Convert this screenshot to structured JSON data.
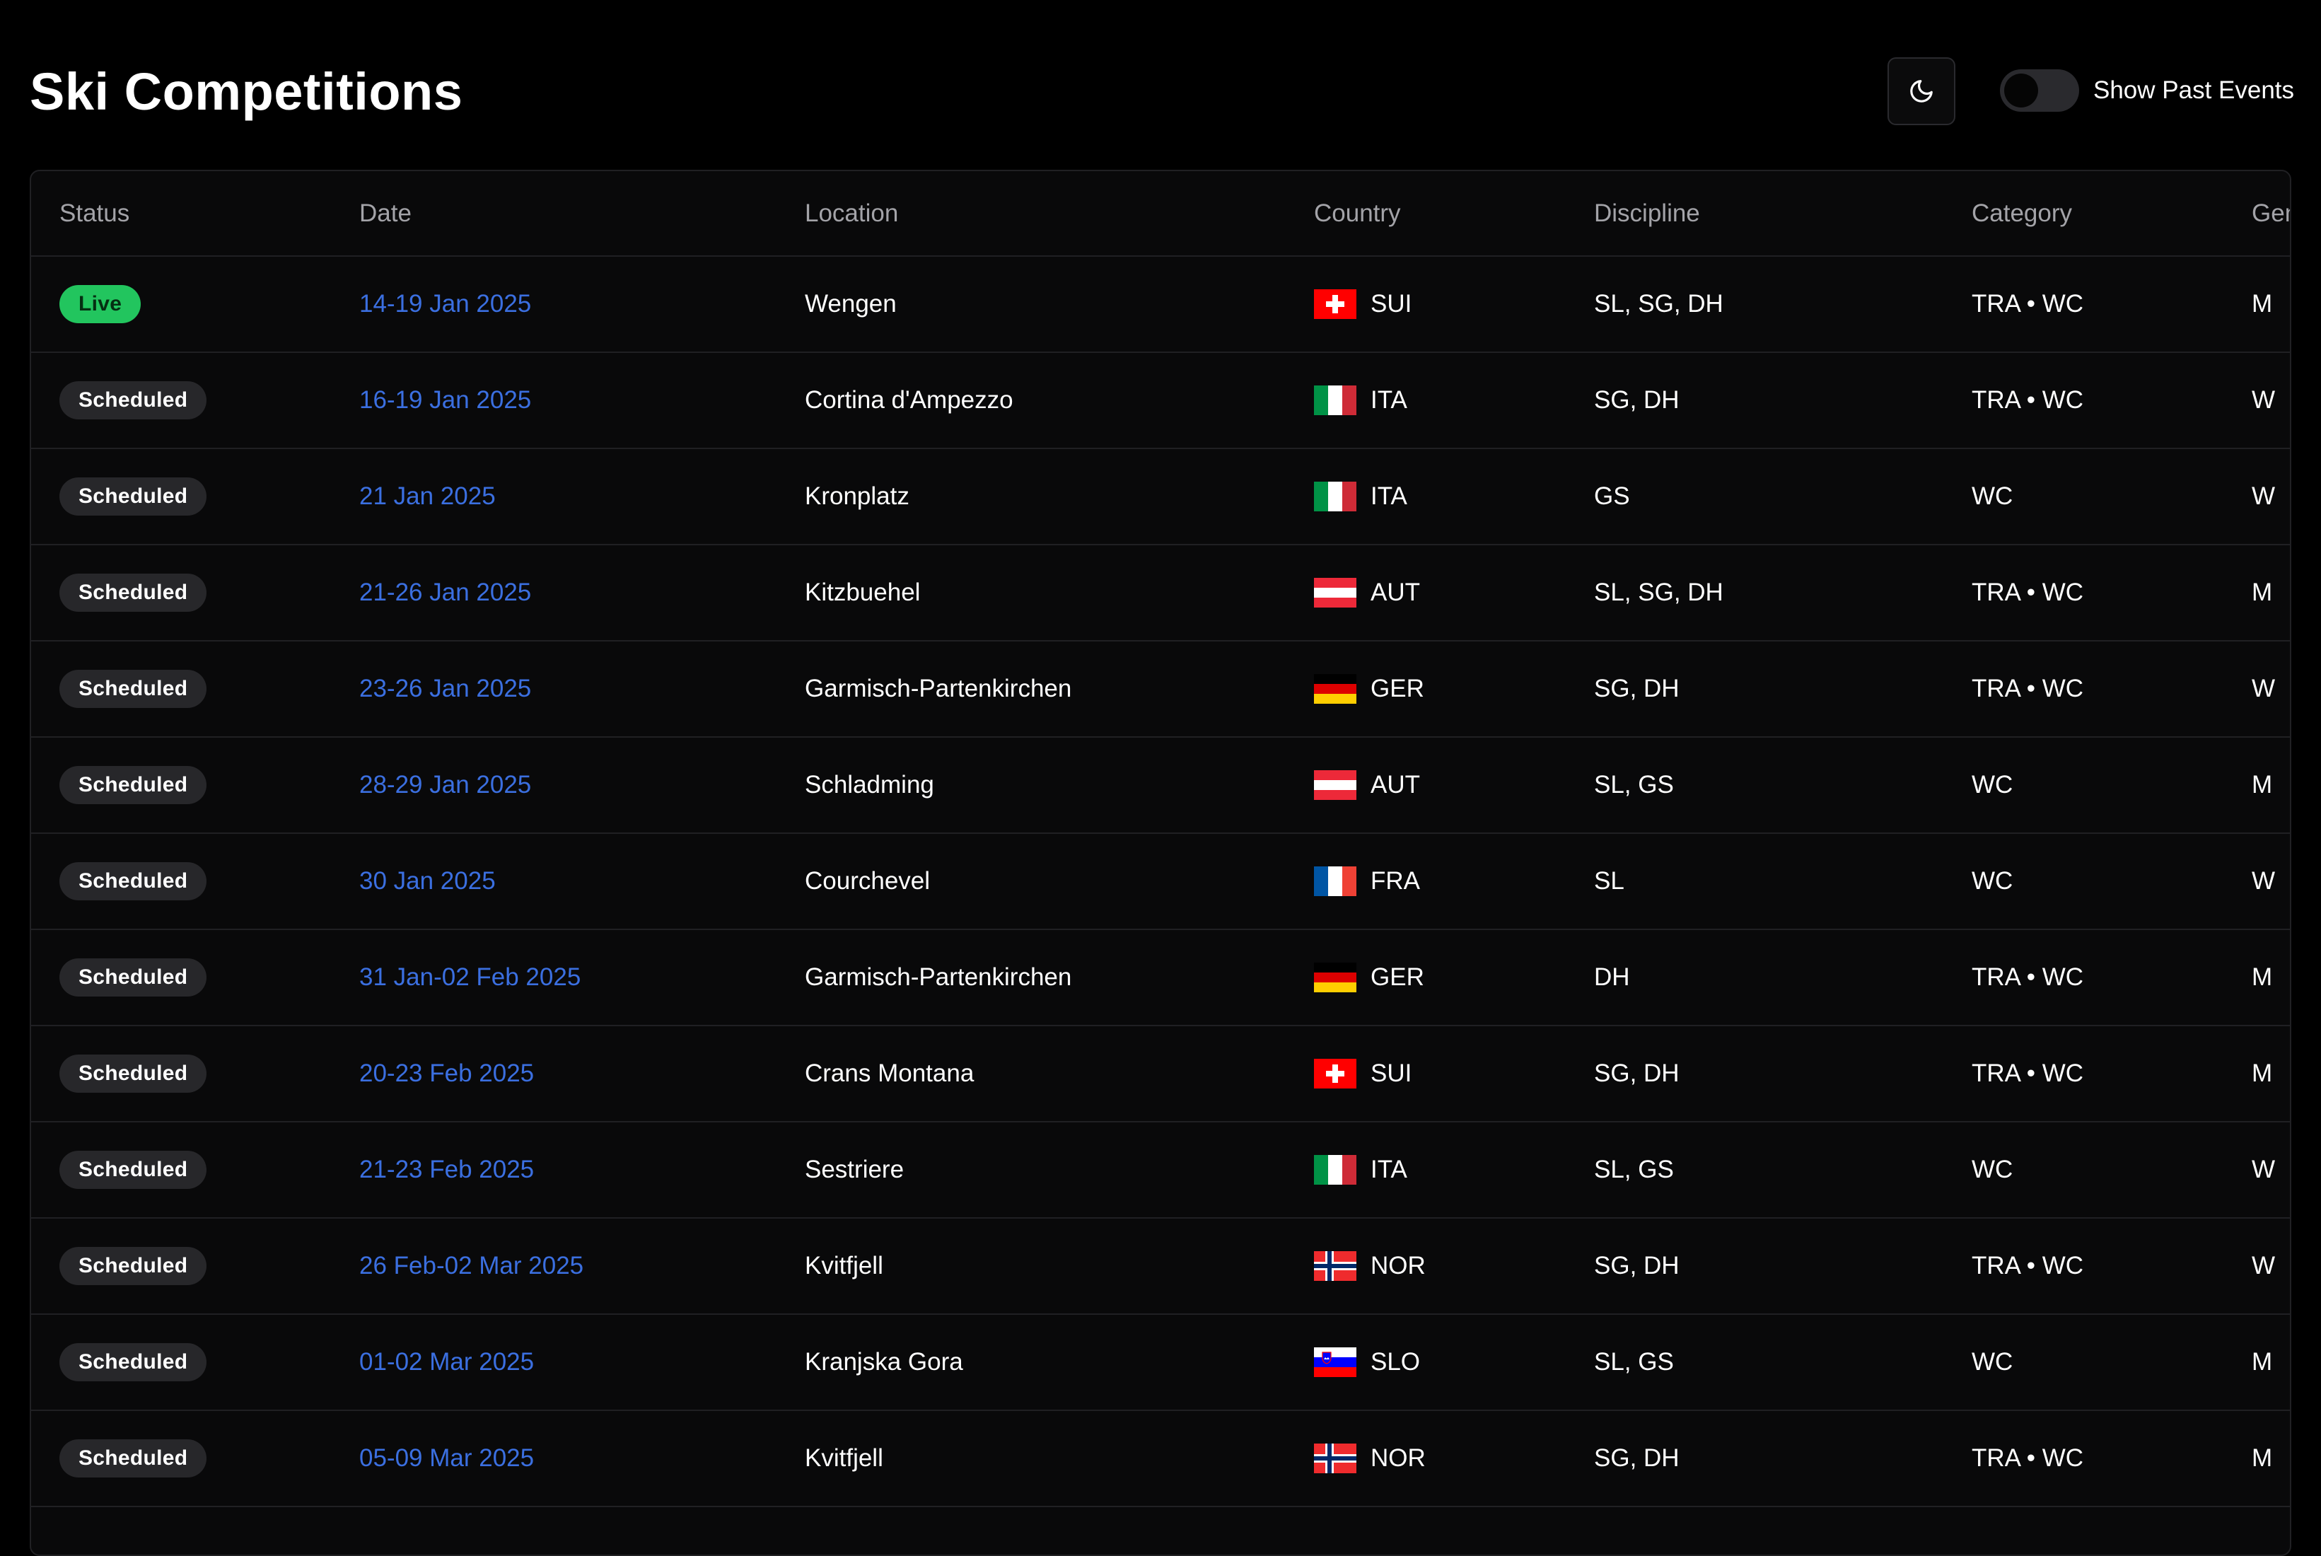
{
  "header": {
    "title": "Ski Competitions",
    "theme_icon": "moon-icon",
    "toggle_label": "Show Past Events",
    "toggle_state": "off"
  },
  "colors": {
    "background": "#000000",
    "live": "#22c55e",
    "scheduled": "#27272a",
    "date_link": "#3b6fe0",
    "muted_header": "#a3a3a8"
  },
  "table": {
    "columns": [
      "Status",
      "Date",
      "Location",
      "Country",
      "Discipline",
      "Category",
      "Gender"
    ],
    "rows": [
      {
        "status": "Live",
        "date": "14-19 Jan 2025",
        "location": "Wengen",
        "country": "SUI",
        "discipline": "SL, SG, DH",
        "category": "TRA • WC",
        "gender": "M"
      },
      {
        "status": "Scheduled",
        "date": "16-19 Jan 2025",
        "location": "Cortina d'Ampezzo",
        "country": "ITA",
        "discipline": "SG, DH",
        "category": "TRA • WC",
        "gender": "W"
      },
      {
        "status": "Scheduled",
        "date": "21 Jan 2025",
        "location": "Kronplatz",
        "country": "ITA",
        "discipline": "GS",
        "category": "WC",
        "gender": "W"
      },
      {
        "status": "Scheduled",
        "date": "21-26 Jan 2025",
        "location": "Kitzbuehel",
        "country": "AUT",
        "discipline": "SL, SG, DH",
        "category": "TRA • WC",
        "gender": "M"
      },
      {
        "status": "Scheduled",
        "date": "23-26 Jan 2025",
        "location": "Garmisch-Partenkirchen",
        "country": "GER",
        "discipline": "SG, DH",
        "category": "TRA • WC",
        "gender": "W"
      },
      {
        "status": "Scheduled",
        "date": "28-29 Jan 2025",
        "location": "Schladming",
        "country": "AUT",
        "discipline": "SL, GS",
        "category": "WC",
        "gender": "M"
      },
      {
        "status": "Scheduled",
        "date": "30 Jan 2025",
        "location": "Courchevel",
        "country": "FRA",
        "discipline": "SL",
        "category": "WC",
        "gender": "W"
      },
      {
        "status": "Scheduled",
        "date": "31 Jan-02 Feb 2025",
        "location": "Garmisch-Partenkirchen",
        "country": "GER",
        "discipline": "DH",
        "category": "TRA • WC",
        "gender": "M"
      },
      {
        "status": "Scheduled",
        "date": "20-23 Feb 2025",
        "location": "Crans Montana",
        "country": "SUI",
        "discipline": "SG, DH",
        "category": "TRA • WC",
        "gender": "M"
      },
      {
        "status": "Scheduled",
        "date": "21-23 Feb 2025",
        "location": "Sestriere",
        "country": "ITA",
        "discipline": "SL, GS",
        "category": "WC",
        "gender": "W"
      },
      {
        "status": "Scheduled",
        "date": "26 Feb-02 Mar 2025",
        "location": "Kvitfjell",
        "country": "NOR",
        "discipline": "SG, DH",
        "category": "TRA • WC",
        "gender": "W"
      },
      {
        "status": "Scheduled",
        "date": "01-02 Mar 2025",
        "location": "Kranjska Gora",
        "country": "SLO",
        "discipline": "SL, GS",
        "category": "WC",
        "gender": "M"
      },
      {
        "status": "Scheduled",
        "date": "05-09 Mar 2025",
        "location": "Kvitfjell",
        "country": "NOR",
        "discipline": "SG, DH",
        "category": "TRA • WC",
        "gender": "M"
      }
    ]
  }
}
